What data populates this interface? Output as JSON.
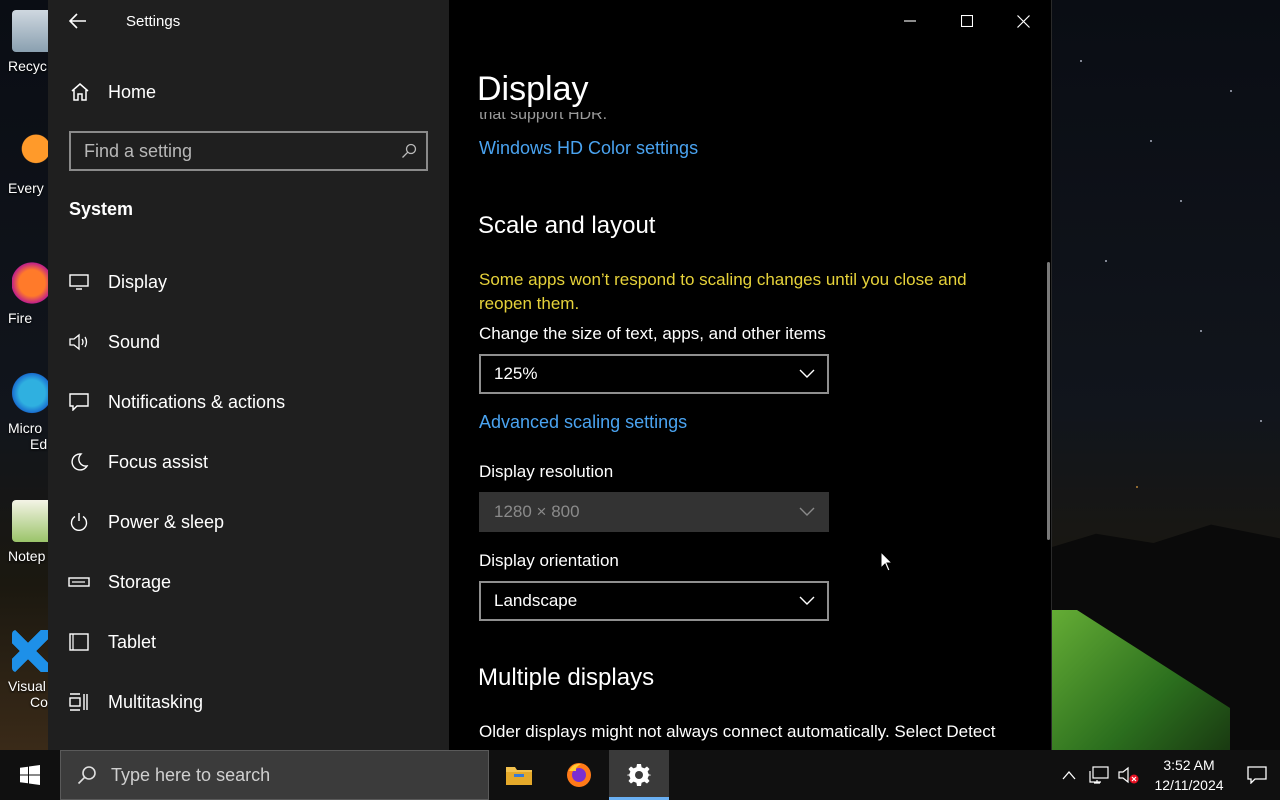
{
  "desktop": {
    "icons": [
      {
        "label": "Recyc",
        "icon": "recycle-bin-icon"
      },
      {
        "label": "Every",
        "icon": "everything-search-icon"
      },
      {
        "label": "Fire",
        "icon": "firefox-icon"
      },
      {
        "label": "Micro",
        "label2": "Ed",
        "icon": "edge-icon"
      },
      {
        "label": "Notep",
        "icon": "notepad-plus-plus-icon"
      },
      {
        "label": "Visual",
        "label2": "Co",
        "icon": "vscode-icon"
      }
    ]
  },
  "window": {
    "title": "Settings",
    "controls": [
      "minimize",
      "maximize",
      "close"
    ]
  },
  "sidebar": {
    "home_label": "Home",
    "search_placeholder": "Find a setting",
    "section": "System",
    "items": [
      {
        "label": "Display",
        "icon": "monitor-icon"
      },
      {
        "label": "Sound",
        "icon": "speaker-icon"
      },
      {
        "label": "Notifications & actions",
        "icon": "notification-icon"
      },
      {
        "label": "Focus assist",
        "icon": "moon-icon"
      },
      {
        "label": "Power & sleep",
        "icon": "power-icon"
      },
      {
        "label": "Storage",
        "icon": "storage-icon"
      },
      {
        "label": "Tablet",
        "icon": "tablet-icon"
      },
      {
        "label": "Multitasking",
        "icon": "multitasking-icon"
      }
    ]
  },
  "content": {
    "page_title": "Display",
    "cut_text": "that support HDR.",
    "hd_color_link": "Windows HD Color settings",
    "scale_heading": "Scale and layout",
    "scale_warning": "Some apps won’t respond to scaling changes until you close and reopen them.",
    "size_label": "Change the size of text, apps, and other items",
    "size_value": "125%",
    "advanced_link": "Advanced scaling settings",
    "resolution_label": "Display resolution",
    "resolution_value": "1280 × 800",
    "orientation_label": "Display orientation",
    "orientation_value": "Landscape",
    "multi_heading": "Multiple displays",
    "multi_text": "Older displays might not always connect automatically. Select Detect"
  },
  "taskbar": {
    "search_placeholder": "Type here to search",
    "apps": [
      {
        "name": "File Explorer",
        "icon": "folder-icon"
      },
      {
        "name": "Firefox",
        "icon": "firefox-icon"
      },
      {
        "name": "Settings",
        "icon": "gear-icon",
        "active": true
      }
    ],
    "time": "3:52 AM",
    "date": "12/11/2024"
  },
  "colors": {
    "link": "#4aa3f0",
    "warning": "#e6d23a",
    "sidebar_bg": "#1f1f1f",
    "content_bg": "#000000",
    "taskbar_accent": "#6ab0f3"
  }
}
